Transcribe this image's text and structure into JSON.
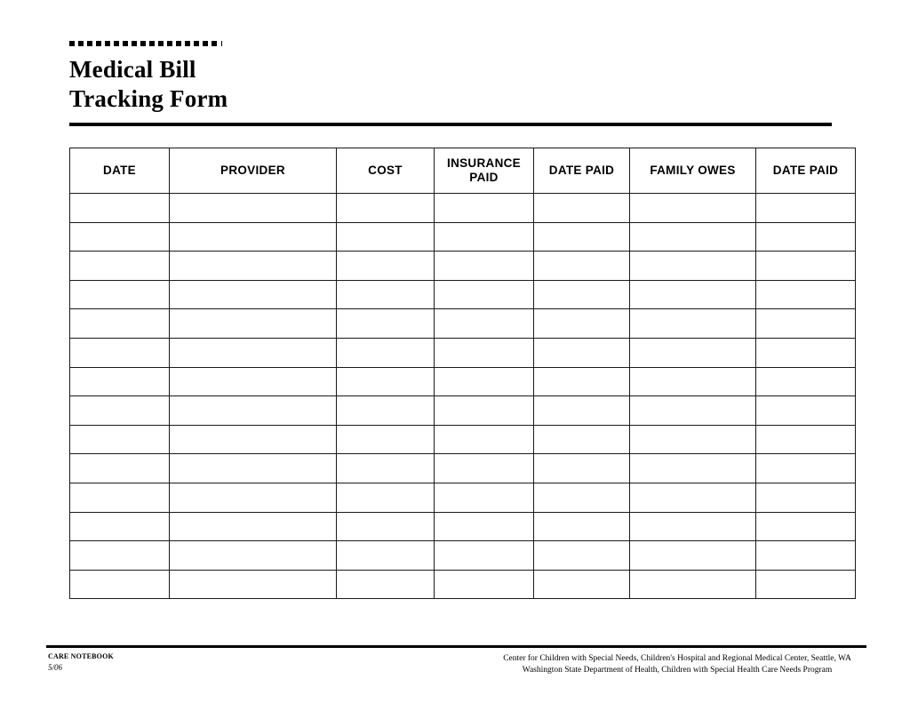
{
  "document": {
    "title_line_1": "Medical Bill",
    "title_line_2": "Tracking Form",
    "title_full": "Medical Bill\nTracking Form",
    "decorative_rule": "square-dot-rule",
    "square_count": 17
  },
  "table": {
    "columns": [
      {
        "key": "date",
        "label": "DATE"
      },
      {
        "key": "provider",
        "label": "PROVIDER"
      },
      {
        "key": "cost",
        "label": "COST"
      },
      {
        "key": "insurance",
        "label": "INSURANCE\nPAID"
      },
      {
        "key": "date_paid_1",
        "label": "DATE PAID"
      },
      {
        "key": "family_owes",
        "label": "FAMILY OWES"
      },
      {
        "key": "date_paid_2",
        "label": "DATE PAID"
      }
    ],
    "row_count": 14,
    "rows": [
      [
        "",
        "",
        "",
        "",
        "",
        "",
        ""
      ],
      [
        "",
        "",
        "",
        "",
        "",
        "",
        ""
      ],
      [
        "",
        "",
        "",
        "",
        "",
        "",
        ""
      ],
      [
        "",
        "",
        "",
        "",
        "",
        "",
        ""
      ],
      [
        "",
        "",
        "",
        "",
        "",
        "",
        ""
      ],
      [
        "",
        "",
        "",
        "",
        "",
        "",
        ""
      ],
      [
        "",
        "",
        "",
        "",
        "",
        "",
        ""
      ],
      [
        "",
        "",
        "",
        "",
        "",
        "",
        ""
      ],
      [
        "",
        "",
        "",
        "",
        "",
        "",
        ""
      ],
      [
        "",
        "",
        "",
        "",
        "",
        "",
        ""
      ],
      [
        "",
        "",
        "",
        "",
        "",
        "",
        ""
      ],
      [
        "",
        "",
        "",
        "",
        "",
        "",
        ""
      ],
      [
        "",
        "",
        "",
        "",
        "",
        "",
        ""
      ],
      [
        "",
        "",
        "",
        "",
        "",
        "",
        ""
      ]
    ]
  },
  "footer": {
    "brand": "CARE NOTEBOOK",
    "revision": "5/06",
    "credit_line_1": "Center for Children with Special Needs, Children's Hospital and Regional Medical Center, Seattle, WA",
    "credit_line_2": "Washington State Department of Health, Children with Special Health Care Needs Program"
  },
  "colors": {
    "ink": "#000000",
    "paper": "#ffffff",
    "rule": "#1a1a1a"
  }
}
